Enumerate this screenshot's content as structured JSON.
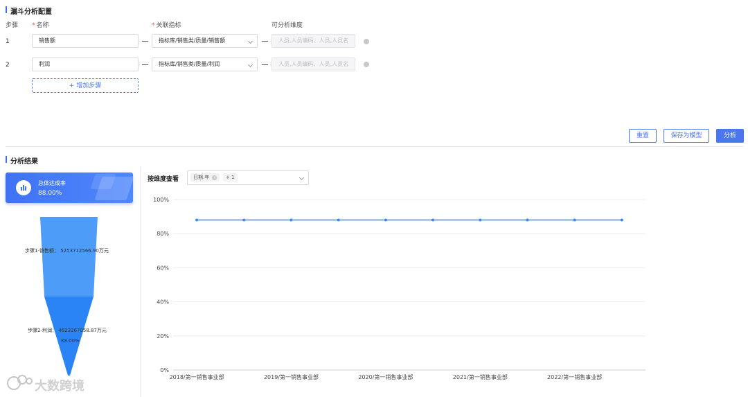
{
  "config": {
    "title": "漏斗分析配置",
    "columns": {
      "step": "步骤",
      "name": "名称",
      "indicator": "关联指标",
      "dimension": "可分析维度"
    },
    "steps": [
      {
        "no": "1",
        "name": "销售额",
        "indicator": "指标库/销售类/质量/销售额",
        "dimension": "人员,人员编码、人员,人员名"
      },
      {
        "no": "2",
        "name": "利润",
        "indicator": "指标库/销售类/质量/利润",
        "dimension": "人员,人员编码、人员,人员名"
      }
    ],
    "add_step_label": "+ 增加步骤",
    "actions": {
      "reset": "重置",
      "save_model": "保存为模型",
      "analyze": "分析"
    }
  },
  "result": {
    "title": "分析结果",
    "kpi": {
      "label": "总体达成率",
      "value": "88.00%"
    },
    "funnel": {
      "steps": [
        {
          "label": "步骤1-销售额： 5253712566.90万元",
          "rate": ""
        },
        {
          "label": "步骤2-利润： 4623267058.87万元",
          "rate": "88.00%"
        }
      ]
    },
    "dimension_filter": {
      "label": "按维度查看",
      "tags": [
        "日期.年",
        "+ 1"
      ]
    }
  },
  "watermark": "大数跨境",
  "colors": {
    "primary": "#4a77ee",
    "line": "#3d8af7",
    "funnel_top": "#4d9cf7",
    "funnel_bottom": "#2b84f5"
  },
  "chart_data": {
    "type": "line",
    "categories": [
      "2018/第一销售事业部",
      "",
      "",
      "",
      "",
      "",
      "",
      "",
      "",
      ""
    ],
    "tick_labels": [
      "2018/第一销售事业部",
      "2019/第一销售事业部",
      "2020/第一销售事业部",
      "2021/第一销售事业部",
      "2022/第一销售事业部"
    ],
    "series": [
      {
        "values": [
          88,
          88,
          88,
          88,
          88,
          88,
          88,
          88,
          88,
          88
        ]
      }
    ],
    "y_ticks": [
      "0%",
      "20%",
      "40%",
      "60%",
      "80%",
      "100%"
    ],
    "ylim": [
      0,
      100
    ],
    "grid": true
  }
}
